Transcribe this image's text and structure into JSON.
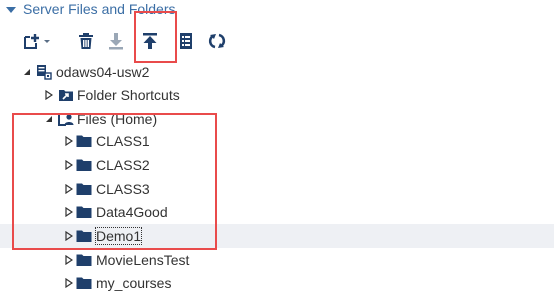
{
  "section": {
    "title": "Server Files and Folders"
  },
  "toolbar": {
    "buttons": [
      {
        "name": "new-menu",
        "icon": "new-file-icon"
      },
      {
        "name": "delete",
        "icon": "trash-icon"
      },
      {
        "name": "download",
        "icon": "download-icon"
      },
      {
        "name": "upload",
        "icon": "upload-icon"
      },
      {
        "name": "properties",
        "icon": "properties-icon"
      },
      {
        "name": "refresh",
        "icon": "refresh-icon"
      }
    ]
  },
  "tree": {
    "server": {
      "label": "odaws04-usw2",
      "icon": "server-icon",
      "expanded": true
    },
    "shortcuts": {
      "label": "Folder Shortcuts",
      "icon": "folder-shortcut-icon",
      "expanded": false
    },
    "home": {
      "label": "Files (Home)",
      "icon": "home-folder-icon",
      "expanded": true
    },
    "folders": [
      {
        "label": "CLASS1",
        "icon": "folder-icon"
      },
      {
        "label": "CLASS2",
        "icon": "folder-icon"
      },
      {
        "label": "CLASS3",
        "icon": "folder-icon"
      },
      {
        "label": "Data4Good",
        "icon": "folder-icon"
      },
      {
        "label": "Demo1",
        "icon": "folder-icon",
        "selected": true
      },
      {
        "label": "MovieLensTest",
        "icon": "folder-icon"
      },
      {
        "label": "my_courses",
        "icon": "folder-icon"
      }
    ]
  },
  "colors": {
    "accent": "#3b6ea5",
    "icon": "#1f3f6b",
    "highlight": "#e94b4b",
    "selected_row": "#eef0f4",
    "text": "#333333"
  }
}
